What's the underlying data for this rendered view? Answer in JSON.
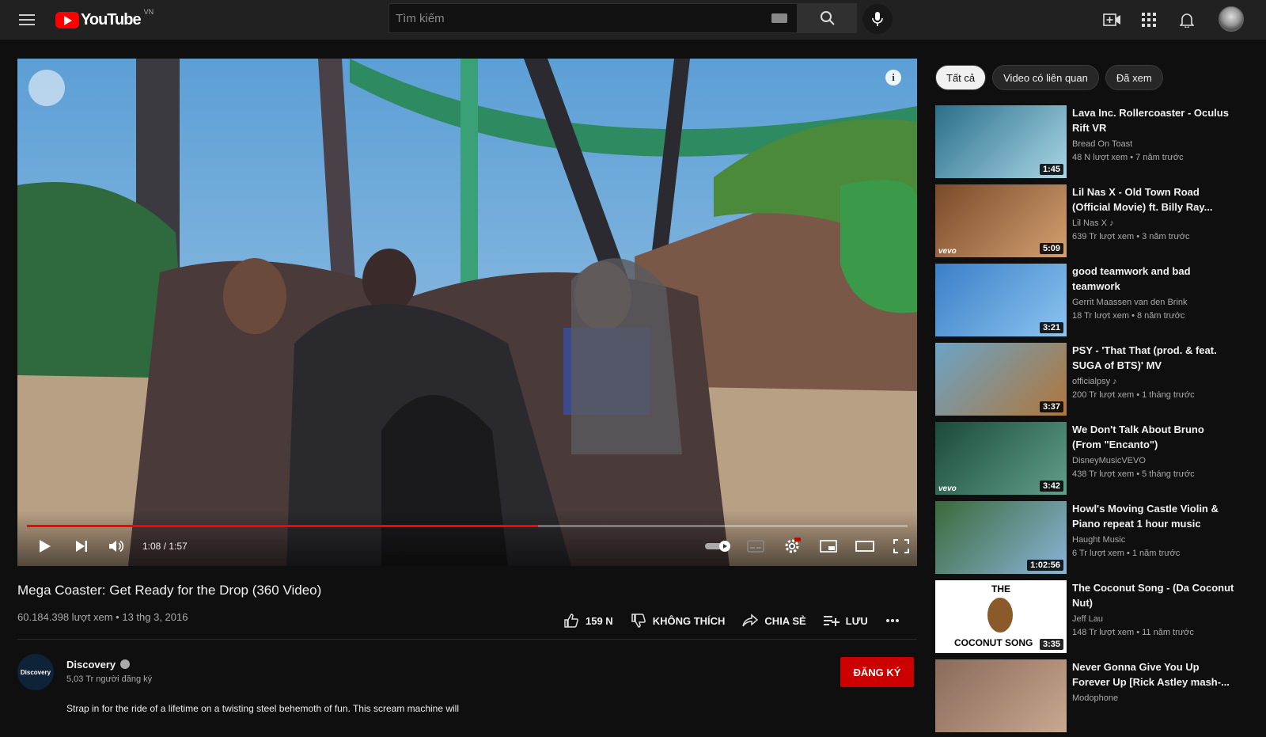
{
  "header": {
    "brand": "YouTube",
    "country": "VN",
    "search_placeholder": "Tìm kiếm"
  },
  "player": {
    "current_time": "1:08",
    "duration": "1:57",
    "time_display": "1:08 / 1:57",
    "progress_fraction": 0.58,
    "accent": "#ff0000"
  },
  "video": {
    "title": "Mega Coaster: Get Ready for the Drop (360 Video)",
    "views": "60.184.398 lượt xem",
    "date": "13 thg 3, 2016",
    "meta": "60.184.398 lượt xem • 13 thg 3, 2016"
  },
  "actions": {
    "like_label": "159 N",
    "dislike_label": "KHÔNG THÍCH",
    "share_label": "CHIA SẺ",
    "save_label": "LƯU"
  },
  "channel": {
    "name": "Discovery",
    "avatar_text": "Discovery",
    "subscribers": "5,03 Tr người đăng ký",
    "subscribe_label": "ĐĂNG KÝ",
    "description": "Strap in for the ride of a lifetime on a twisting steel behemoth of fun. This scream machine will"
  },
  "chips": [
    "Tất cả",
    "Video có liên quan",
    "Đã xem"
  ],
  "recommendations": [
    {
      "title": "Lava Inc. Rollercoaster - Oculus Rift VR",
      "channel": "Bread On Toast",
      "meta": "48 N lượt xem • 7 năm trước",
      "duration": "1:45",
      "color1": "#2a6f8a",
      "color2": "#a9d6e6"
    },
    {
      "title": "Lil Nas X - Old Town Road (Official Movie) ft. Billy Ray...",
      "channel": "Lil Nas X ♪",
      "meta": "639 Tr lượt xem • 3 năm trước",
      "duration": "5:09",
      "color1": "#7a4a2a",
      "color2": "#d2a070",
      "vevo": "vevo"
    },
    {
      "title": "good teamwork and bad teamwork",
      "channel": "Gerrit Maassen van den Brink",
      "meta": "18 Tr lượt xem • 8 năm trước",
      "duration": "3:21",
      "color1": "#3a7fc8",
      "color2": "#8cc4f0"
    },
    {
      "title": "PSY - 'That That (prod. & feat. SUGA of BTS)' MV",
      "channel": "officialpsy ♪",
      "meta": "200 Tr lượt xem • 1 tháng trước",
      "duration": "3:37",
      "color1": "#6aa4c8",
      "color2": "#b0763a"
    },
    {
      "title": "We Don't Talk About Bruno (From \"Encanto\")",
      "channel": "DisneyMusicVEVO",
      "meta": "438 Tr lượt xem • 5 tháng trước",
      "duration": "3:42",
      "color1": "#1c4a3a",
      "color2": "#5fa08a",
      "vevo": "vevo"
    },
    {
      "title": "Howl's Moving Castle Violin & Piano repeat 1 hour music",
      "channel": "Haught Music",
      "meta": "6 Tr lượt xem • 1 năm trước",
      "duration": "1:02:56",
      "color1": "#3a6a3a",
      "color2": "#8ab4d8"
    },
    {
      "title": "The Coconut Song - (Da Coconut Nut)",
      "channel": "Jeff Lau",
      "meta": "148 Tr lượt xem • 11 năm trước",
      "duration": "3:35",
      "color1": "#ffffff",
      "color2": "#ffffff",
      "thumb_text_top": "THE",
      "thumb_text_bottom": "COCONUT SONG"
    },
    {
      "title": "Never Gonna Give You Up Forever Up [Rick Astley mash-...",
      "channel": "Modophone",
      "meta": "",
      "duration": "",
      "color1": "#8a6a5a",
      "color2": "#c8a890"
    }
  ]
}
